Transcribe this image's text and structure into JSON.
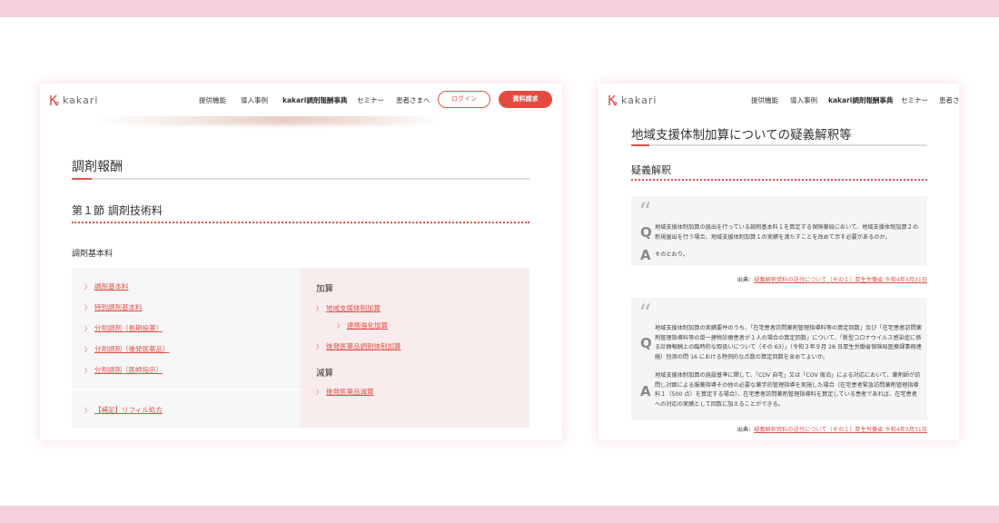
{
  "left": {
    "brand": "kakari",
    "nav": [
      "提供機能",
      "導入事例",
      "kakari調剤報酬事典",
      "セミナー",
      "患者さまへ"
    ],
    "login_label": "ログイン",
    "request_label": "資料請求",
    "page_heading": "調剤報酬",
    "section_heading": "第１節 調剤技術料",
    "subsection_heading": "調剤基本料",
    "links_left": [
      "調剤基本料",
      "特別調剤基本料",
      "分割調剤（長期投薬）",
      "分割調剤（後発医薬品）",
      "分割調剤（医師指示）"
    ],
    "link_supplement": "【補足】リフィル処方",
    "kasan_heading": "加算",
    "kasan_links": {
      "main": "地域支援体制加算",
      "sub": "連携強化加算",
      "generic": "後発医薬品調剤体制加算"
    },
    "gensan_heading": "減算",
    "gensan_link": "後発医薬品減算"
  },
  "right": {
    "brand": "kakari",
    "nav": [
      "提供機能",
      "導入事例",
      "kakari調剤報酬事典",
      "セミナー",
      "患者さ"
    ],
    "page_title": "地域支援体制加算についての疑義解釈等",
    "section_heading": "疑義解釈",
    "qa1": {
      "q": "地域支援体制加算の届出を行っている調剤基本料１を算定する保険薬局において、地域支援体制加算２の新規届出を行う場合、地域支援体制加算１の実績を満たすことを改めて示す必要があるのか。",
      "a": "そのとおり。",
      "source_prefix": "出典：",
      "source_link": "疑義解釈資料の送付について（その１）厚生労働省 令和4年3月31日"
    },
    "qa2": {
      "q": "地域支援体制加算の実績要件のうち、「在宅患者訪問薬剤管理指導料等の算定回数」及び「在宅患者訪問薬剤管理指導料等の単一建物診療患者が１人の場合の算定回数」について、「新型コロナウイルス感染症に係る診療報酬上の臨時的な取扱いについて（その 63）」（令和３年９月 28 日厚生労働省保険局医療課事務連絡）別添の問 16 における特例的な点数の算定回数を含めてよいか。",
      "a": "地域支援体制加算の施設基準に関して、「COV 自宅」又は「COV 宿泊」による対応において、薬剤師が訪問し対面による服薬指導その他の必要な薬学的管理指導を実施した場合（在宅患者緊急訪問薬剤管理指導料１（500 点）を算定する場合）、在宅患者訪問薬剤管理指導料を算定している患者であれば、在宅患者への対応の実績として回数に加えることができる。",
      "source_prefix": "出典：",
      "source_link": "疑義解釈資料の送付について（その１）厚生労働省 令和4年3月31日"
    },
    "quote_glyph": "“",
    "q_letter": "Q",
    "a_letter": "A"
  },
  "colors": {
    "accent": "#e0524c",
    "band": "#f3d0da",
    "box_left": "#f6f6f6",
    "box_right": "#f9ecec"
  }
}
